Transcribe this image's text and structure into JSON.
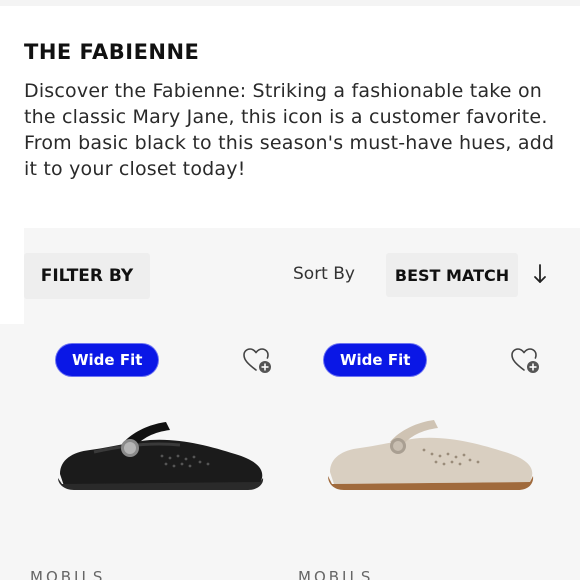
{
  "collection": {
    "title": "THE FABIENNE",
    "description": "Discover the Fabienne: Striking a fashionable take on the classic Mary Jane, this icon is a customer favorite. From basic black to this season's must-have hues, add it to your closet today!"
  },
  "toolbar": {
    "filter_label": "FILTER BY",
    "sort_label": "Sort By",
    "sort_value": "BEST MATCH",
    "sort_direction_icon": "arrow-down-icon"
  },
  "products": [
    {
      "badge": "Wide Fit",
      "brand": "MOBILS",
      "wishlist_icon": "heart-plus-icon",
      "color_name": "black",
      "shoe_color": "#1b1b1b",
      "sole_color": "#2a2a2a"
    },
    {
      "badge": "Wide Fit",
      "brand": "MOBILS",
      "wishlist_icon": "heart-plus-icon",
      "color_name": "beige",
      "shoe_color": "#d9cfc1",
      "sole_color": "#a06a3c"
    }
  ],
  "colors": {
    "badge_blue": "#0a17e6",
    "panel_gray": "#f6f6f6",
    "button_gray": "#eeeeee"
  }
}
